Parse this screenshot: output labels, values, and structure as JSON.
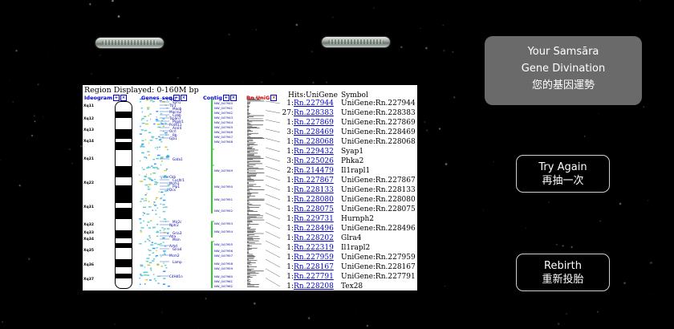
{
  "divination": {
    "line1": "Your Samsāra",
    "line2": "Gene Divination",
    "line3": "您的基因運勢"
  },
  "buttons": {
    "try_again_en": "Try Again",
    "try_again_zh": "再抽一次",
    "rebirth_en": "Rebirth",
    "rebirth_zh": "重新投胎"
  },
  "genome_panel": {
    "region_title": "Region Displayed: 0-160M bp",
    "track_headers": {
      "ideogram": "Ideogram",
      "genes_seq": "Genes_seq",
      "contig": "Contig",
      "rn_unig": "Rn UniG",
      "hits": "Hits:UniGene",
      "symbol": "Symbol"
    },
    "bands": [
      "Xq11",
      "Xq12",
      "Xq13",
      "Xq14",
      "Xq21",
      "Xq22",
      "Xq31",
      "Xq32",
      "Xq33",
      "Xq34",
      "Xq35",
      "Xq36",
      "Xq37"
    ],
    "gene_labels": [
      "Elk1",
      "Syn1",
      "Ttr1",
      "Maob",
      "Macro2",
      "Cybb",
      "Tspan7",
      "Ptgdr1",
      "Pcdh11",
      "Acsl4",
      "Ocrl",
      "Rb",
      "Gjb1",
      "Gata1",
      "Ckb",
      "Cysltr1",
      "Mcm1",
      "Plp1",
      "Dcx",
      "Mir2c",
      "Nptr2",
      "Gria3",
      "Atrx",
      "Msin",
      "Arhd",
      "Glra4",
      "Mcm2",
      "Lamp",
      "C4Hd1n"
    ],
    "contig_labels": [
      "NW_047940",
      "NW_047941",
      "NW_047942",
      "NW_047943",
      "NW_047944",
      "NW_047945",
      "NW_047946",
      "NW_047947",
      "NW_047948",
      "NW_047949",
      "NW_047950",
      "NW_047951",
      "NW_047952",
      "NW_047953",
      "NW_047954",
      "NW_047955",
      "NW_047956",
      "NW_047957",
      "NW_047958",
      "NW_047959",
      "NW_047960",
      "NW_047961",
      "NW_047962"
    ],
    "hits": [
      {
        "count": "1",
        "id": "Rn.227944",
        "symbol": "UniGene:Rn.227944"
      },
      {
        "count": "27",
        "id": "Rn.228383",
        "symbol": "UniGene:Rn.228383"
      },
      {
        "count": "1",
        "id": "Rn.227869",
        "symbol": "UniGene:Rn.227869"
      },
      {
        "count": "3",
        "id": "Rn.228469",
        "symbol": "UniGene:Rn.228469"
      },
      {
        "count": "1",
        "id": "Rn.228068",
        "symbol": "UniGene:Rn.228068"
      },
      {
        "count": "1",
        "id": "Rn.229432",
        "symbol": "Syap1"
      },
      {
        "count": "3",
        "id": "Rn.225026",
        "symbol": "Phka2"
      },
      {
        "count": "2",
        "id": "Rn.214479",
        "symbol": "Il1rapl1"
      },
      {
        "count": "1",
        "id": "Rn.227867",
        "symbol": "UniGene:Rn.227867"
      },
      {
        "count": "1",
        "id": "Rn.228133",
        "symbol": "UniGene:Rn.228133"
      },
      {
        "count": "1",
        "id": "Rn.228080",
        "symbol": "UniGene:Rn.228080"
      },
      {
        "count": "1",
        "id": "Rn.228075",
        "symbol": "UniGene:Rn.228075"
      },
      {
        "count": "1",
        "id": "Rn.229731",
        "symbol": "Hurnph2"
      },
      {
        "count": "1",
        "id": "Rn.228496",
        "symbol": "UniGene:Rn.228496"
      },
      {
        "count": "1",
        "id": "Rn.228202",
        "symbol": "Glra4"
      },
      {
        "count": "1",
        "id": "Rn.222319",
        "symbol": "Il1rapl2"
      },
      {
        "count": "1",
        "id": "Rn.227959",
        "symbol": "UniGene:Rn.227959"
      },
      {
        "count": "1",
        "id": "Rn.228167",
        "symbol": "UniGene:Rn.228167"
      },
      {
        "count": "1",
        "id": "Rn.227791",
        "symbol": "UniGene:Rn.227791"
      },
      {
        "count": "1",
        "id": "Rn.228208",
        "symbol": "Tex28"
      }
    ]
  },
  "colors": {
    "background": "#000000",
    "panel_bg": "#6a6a6a",
    "link": "#0000cc",
    "contig_green": "#33cc33",
    "gene_cyan": "#66cccc"
  }
}
